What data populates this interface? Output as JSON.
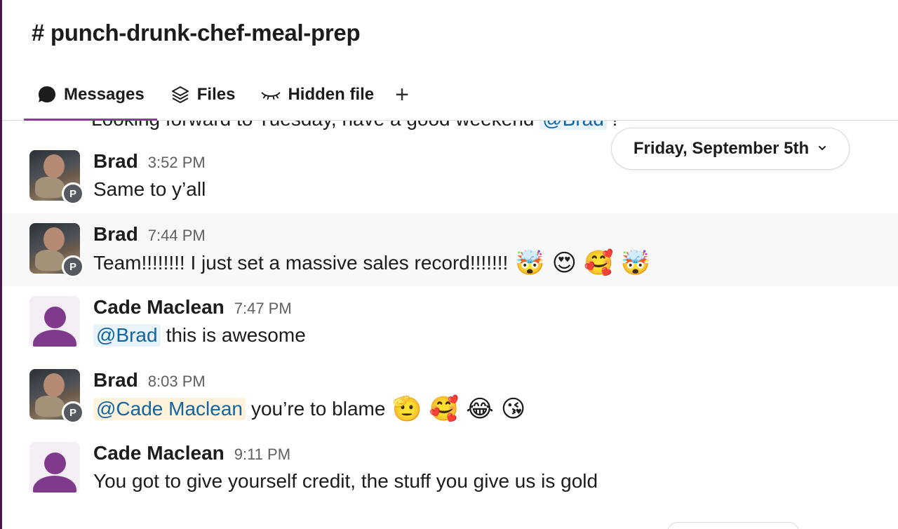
{
  "channel": {
    "title": "# punch-drunk-chef-meal-prep"
  },
  "tabs": [
    {
      "label": "Messages",
      "icon": "chat-bubble-icon",
      "active": true
    },
    {
      "label": "Files",
      "icon": "layers-icon",
      "active": false
    },
    {
      "label": "Hidden file",
      "icon": "closed-eye-icon",
      "active": false
    },
    {
      "label": "+",
      "icon": "plus-icon",
      "active": false
    }
  ],
  "date_divider": {
    "label": "Friday, September 5th",
    "icon": "chevron-down-icon"
  },
  "cut_message": {
    "text": "Looking forward to Tuesday, have a good weekend",
    "mention": "@Brad",
    "trailing": "!"
  },
  "messages": [
    {
      "author": "Brad",
      "time": "3:52 PM",
      "badge": "P",
      "text": "Same to y’all",
      "emojis": []
    },
    {
      "author": "Brad",
      "time": "7:44 PM",
      "badge": "P",
      "text": "Team!!!!!!!! I just set a massive sales record!!!!!!!",
      "emojis": [
        "🤯",
        "😍",
        "🥰",
        "🤯"
      ],
      "highlighted": true
    },
    {
      "author": "Cade Maclean",
      "time": "7:47 PM",
      "mention": "@Brad",
      "text": "this is awesome",
      "emojis": []
    },
    {
      "author": "Brad",
      "time": "8:03 PM",
      "badge": "P",
      "mention": "@Cade Maclean",
      "text": "you’re to blame",
      "emojis": [
        "🫡",
        "🥰",
        "😂",
        "😘"
      ]
    },
    {
      "author": "Cade Maclean",
      "time": "9:11 PM",
      "text": "You got to give yourself credit, the stuff you give us is gold",
      "emojis": []
    }
  ],
  "colors": {
    "accent": "#8b3a96",
    "mention_bg": "#e8f3fa",
    "mention_self_bg": "#fdf3dc",
    "mention_text": "#1264a3"
  }
}
